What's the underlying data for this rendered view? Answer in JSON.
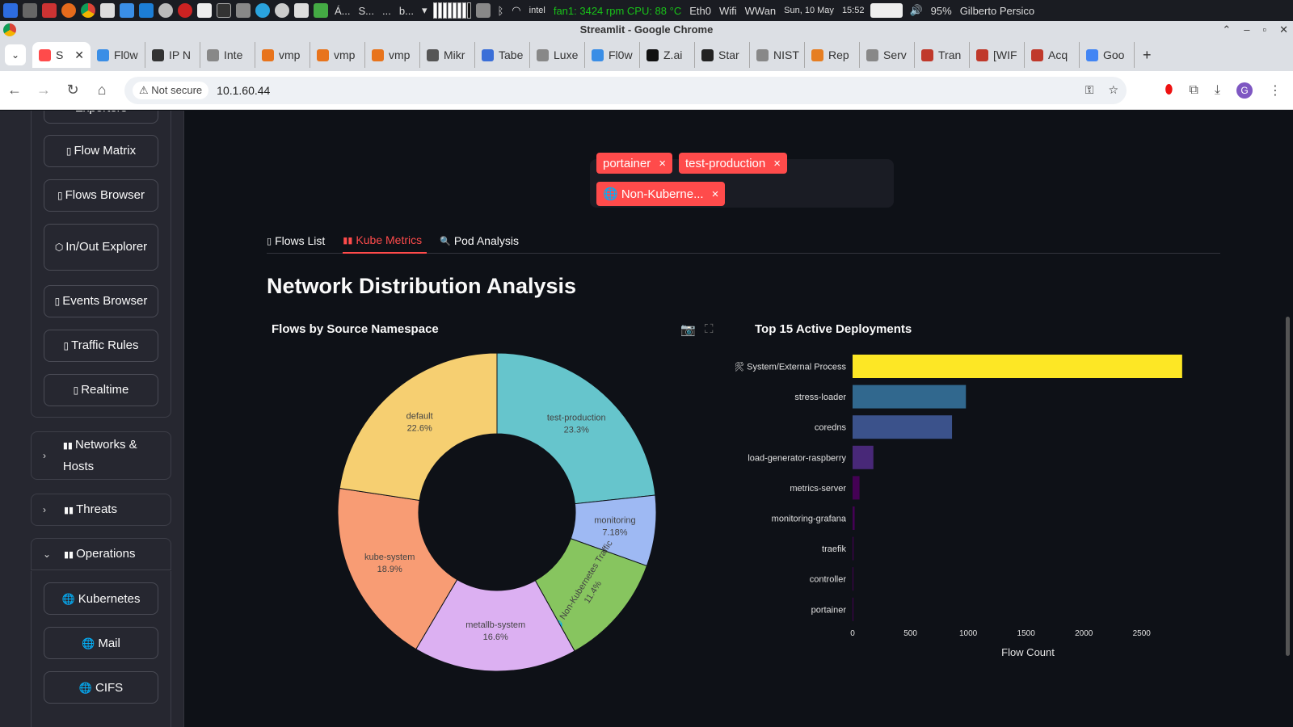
{
  "os_panel": {
    "taskbar_items": [
      "Á...",
      "S...",
      "...",
      "b..."
    ],
    "fan_text": "fan1: 3424 rpm  CPU: 88 °C",
    "network_labels": [
      "Eth0",
      "Wifi",
      "WWan"
    ],
    "date": "Sun, 10 May",
    "time": "15:52",
    "battery": "95%",
    "user": "Gilberto Persico"
  },
  "browser": {
    "window_title": "Streamlit - Google Chrome",
    "tabs": [
      {
        "label": "S",
        "icon": "streamlit-icon",
        "active": true,
        "close": "✕"
      },
      {
        "label": "Fl0w",
        "icon": "flow-icon"
      },
      {
        "label": "IP N",
        "icon": "crown-icon"
      },
      {
        "label": "Inte",
        "icon": "globe-icon"
      },
      {
        "label": "vmp",
        "icon": "x-icon"
      },
      {
        "label": "vmp",
        "icon": "x-icon"
      },
      {
        "label": "vmp",
        "icon": "x-icon"
      },
      {
        "label": "Mikr",
        "icon": "router-icon"
      },
      {
        "label": "Tabe",
        "icon": "star-icon"
      },
      {
        "label": "Luxe",
        "icon": "globe-icon"
      },
      {
        "label": "Fl0w",
        "icon": "flow-icon"
      },
      {
        "label": "Z.ai",
        "icon": "z-icon"
      },
      {
        "label": "Star",
        "icon": "s-icon"
      },
      {
        "label": "NIST",
        "icon": "globe-icon"
      },
      {
        "label": "Rep",
        "icon": "sun-icon"
      },
      {
        "label": "Serv",
        "icon": "globe-icon"
      },
      {
        "label": "Tran",
        "icon": "doc-icon"
      },
      {
        "label": "[WIF",
        "icon": "circle-icon"
      },
      {
        "label": "Acq",
        "icon": "circle-icon"
      },
      {
        "label": "Goo",
        "icon": "translate-icon"
      }
    ],
    "new_tab": "+",
    "security": "Not secure",
    "url": "10.1.60.44",
    "avatar_letter": "G"
  },
  "sidebar": {
    "partial_top_label": "Exporters",
    "buttons": [
      {
        "label": "Flow Matrix",
        "icon": "▯"
      },
      {
        "label": "Flows Browser",
        "icon": "▯"
      },
      {
        "label": "In/Out Explorer",
        "icon": "⬡"
      },
      {
        "label": "Events Browser",
        "icon": "▯"
      },
      {
        "label": "Traffic Rules",
        "icon": "▯"
      },
      {
        "label": "Realtime",
        "icon": "▯"
      }
    ],
    "expanders": [
      {
        "label": "Networks & Hosts",
        "icon": "▮▮",
        "chevron": "›",
        "expanded": false
      },
      {
        "label": "Threats",
        "icon": "▮▮",
        "chevron": "›",
        "expanded": false
      },
      {
        "label": "Operations",
        "icon": "▮▮",
        "chevron": "⌄",
        "expanded": true
      }
    ],
    "operations_buttons": [
      {
        "label": "Kubernetes",
        "icon": "🌐"
      },
      {
        "label": "Mail",
        "icon": "🌐"
      },
      {
        "label": "CIFS",
        "icon": "🌐"
      }
    ]
  },
  "filter": {
    "chips": [
      {
        "label": "portainer",
        "x": "×"
      },
      {
        "label": "test-production",
        "x": "×"
      },
      {
        "label": "🌐 Non-Kuberne...",
        "x": "×"
      }
    ]
  },
  "tabs": [
    {
      "label": "Flows List",
      "icon": "▯",
      "active": false
    },
    {
      "label": "Kube Metrics",
      "icon": "▮▮",
      "active": true
    },
    {
      "label": "Pod Analysis",
      "icon": "🔍",
      "active": false
    }
  ],
  "section_title": "Network Distribution Analysis",
  "colors": {
    "accent": "#ff4b4b",
    "bg": "#0e1117",
    "sidebar": "#262730"
  },
  "chart_data": [
    {
      "type": "pie",
      "title": "Flows by Source Namespace",
      "hole": 0.5,
      "slices": [
        {
          "label": "test-production",
          "value": 23.3,
          "text": "23.3%",
          "color": "#66c5cc"
        },
        {
          "label": "monitoring",
          "value": 7.18,
          "text": "7.18%",
          "color": "#9eb9f3"
        },
        {
          "label": "🌐 Non-Kubernetes Traffic",
          "value": 11.4,
          "text": "11.4%",
          "color": "#87c55f"
        },
        {
          "label": "metallb-system",
          "value": 16.6,
          "text": "16.6%",
          "color": "#dcb0f2"
        },
        {
          "label": "kube-system",
          "value": 18.9,
          "text": "18.9%",
          "color": "#f89c74"
        },
        {
          "label": "default",
          "value": 22.6,
          "text": "22.6%",
          "color": "#f6cf71"
        }
      ]
    },
    {
      "type": "bar",
      "orientation": "horizontal",
      "title": "Top 15 Active Deployments",
      "xlabel": "Flow Count",
      "xlim": [
        0,
        2900
      ],
      "xticks": [
        0,
        500,
        1000,
        1500,
        2000,
        2500
      ],
      "categories": [
        "🛠 System/External Process",
        "stress-loader",
        "coredns",
        "load-generator-raspberry",
        "metrics-server",
        "monitoring-grafana",
        "traefik",
        "controller",
        "portainer"
      ],
      "values": [
        2850,
        980,
        860,
        180,
        60,
        18,
        8,
        6,
        3
      ],
      "colors": [
        "#fde725",
        "#31688e",
        "#3b528b",
        "#482878",
        "#440154",
        "#440154",
        "#440154",
        "#440154",
        "#440154"
      ]
    }
  ]
}
